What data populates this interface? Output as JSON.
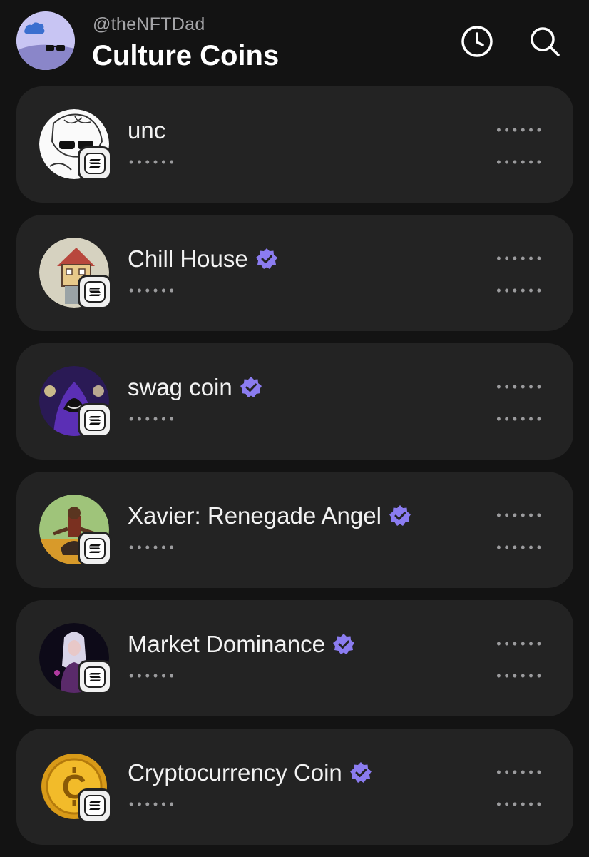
{
  "header": {
    "handle": "@theNFTDad",
    "title": "Culture Coins",
    "history_icon": "clock-icon",
    "search_icon": "search-icon"
  },
  "colors": {
    "background": "#131313",
    "card": "#232323",
    "verified": "#8b7cf0",
    "muted_text": "#a5a5a8"
  },
  "coins": [
    {
      "name": "unc",
      "verified": false,
      "subtitle": "••••••",
      "price": "••••••",
      "change": "••••••",
      "chain_icon": "solana-icon"
    },
    {
      "name": "Chill House",
      "verified": true,
      "subtitle": "••••••",
      "price": "••••••",
      "change": "••••••",
      "chain_icon": "solana-icon"
    },
    {
      "name": "swag coin",
      "verified": true,
      "subtitle": "••••••",
      "price": "••••••",
      "change": "••••••",
      "chain_icon": "solana-icon"
    },
    {
      "name": "Xavier: Renegade Angel",
      "verified": true,
      "subtitle": "••••••",
      "price": "••••••",
      "change": "••••••",
      "chain_icon": "solana-icon"
    },
    {
      "name": "Market Dominance",
      "verified": true,
      "subtitle": "••••••",
      "price": "••••••",
      "change": "••••••",
      "chain_icon": "solana-icon"
    },
    {
      "name": "Cryptocurrency Coin",
      "verified": true,
      "subtitle": "••••••",
      "price": "••••••",
      "change": "••••••",
      "chain_icon": "solana-icon"
    }
  ]
}
